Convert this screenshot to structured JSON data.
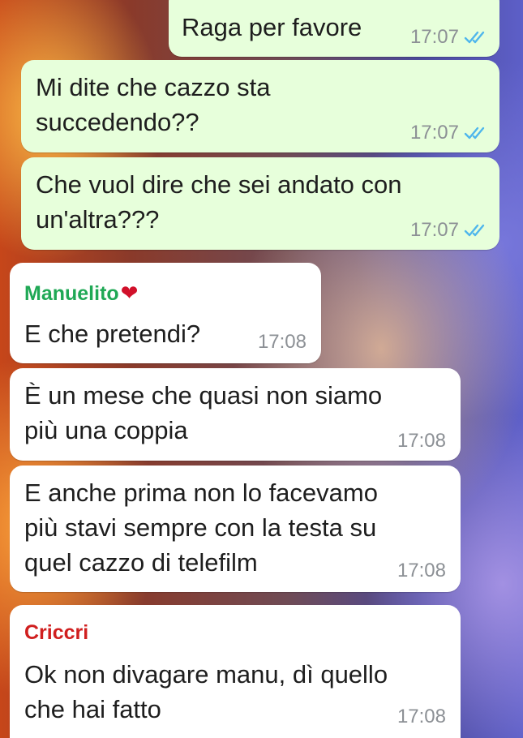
{
  "messages": [
    {
      "direction": "outgoing",
      "text": "Raga per favore",
      "time": "17:07",
      "status": "read"
    },
    {
      "direction": "outgoing",
      "text": "Mi dite che cazzo sta\nsuccedendo??",
      "time": "17:07",
      "status": "read"
    },
    {
      "direction": "outgoing",
      "text": "Che vuol dire che sei andato con\nun'altra???",
      "time": "17:07",
      "status": "read"
    },
    {
      "direction": "incoming",
      "sender": "Manuelito",
      "sender_emoji": "❤",
      "sender_color": "#1fa855",
      "text": "E che pretendi?",
      "time": "17:08"
    },
    {
      "direction": "incoming",
      "text": "È un mese che quasi non siamo\npiù una coppia",
      "time": "17:08"
    },
    {
      "direction": "incoming",
      "text": "E anche prima non lo facevamo\npiù stavi sempre con la testa su\nquel cazzo di telefilm",
      "time": "17:08"
    },
    {
      "direction": "incoming",
      "sender": "Criccri",
      "sender_color": "#d01f1f",
      "text": "Ok non divagare manu, dì quello\nche hai fatto",
      "time": "17:08"
    }
  ],
  "colors": {
    "outgoing_bubble": "#e7ffdb",
    "incoming_bubble": "#ffffff",
    "read_ticks": "#4fb6ec"
  }
}
